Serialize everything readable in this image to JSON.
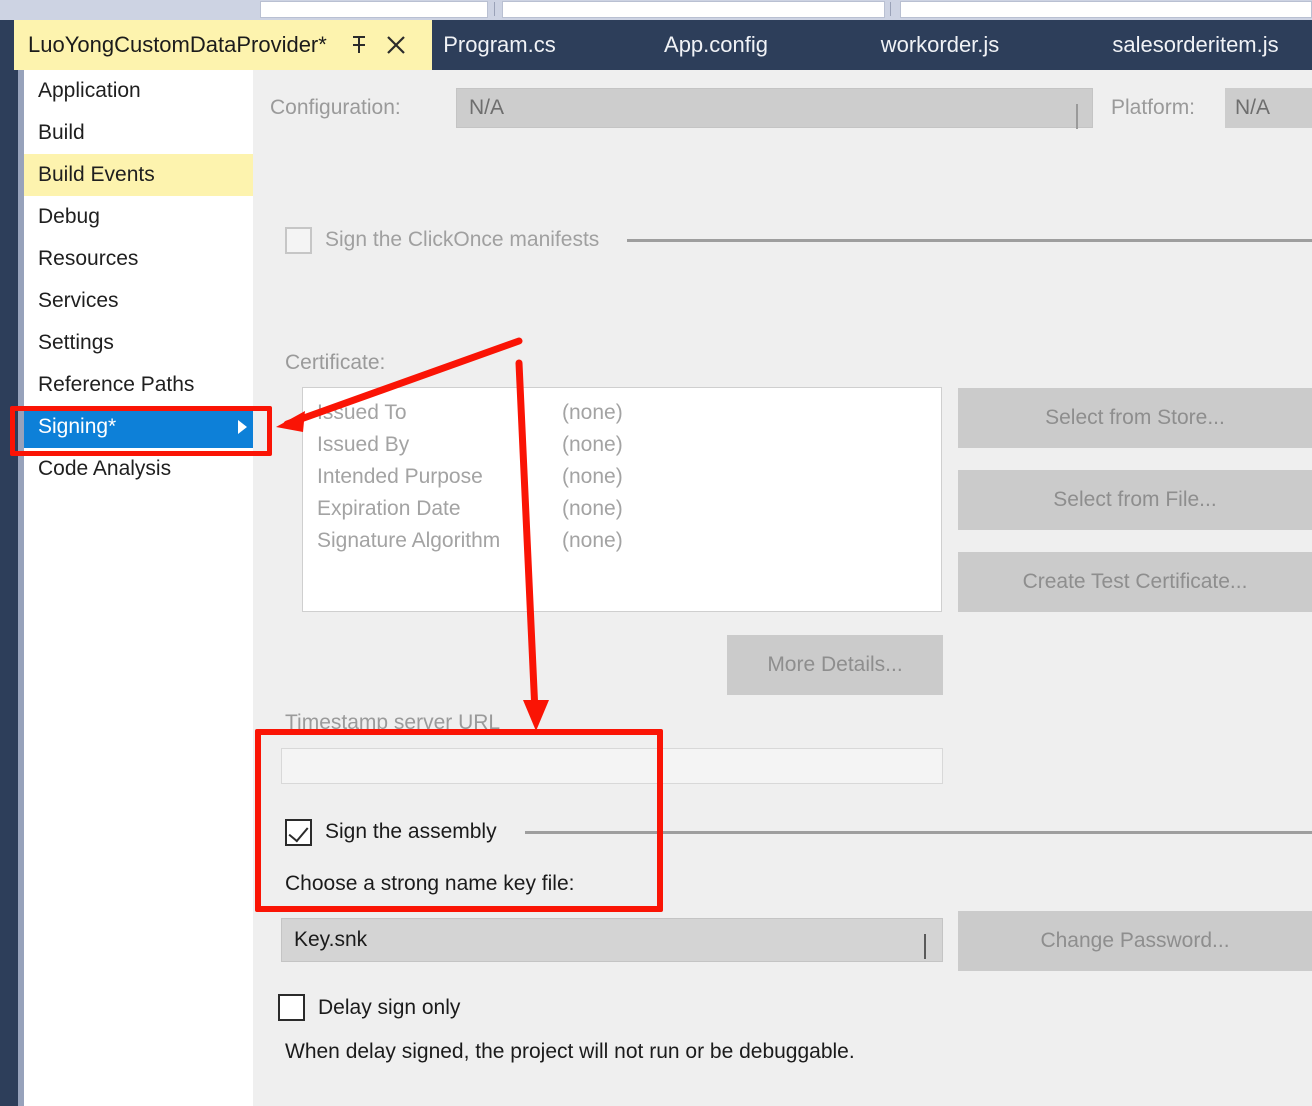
{
  "window": {
    "title": "LuoYongCustomDataProvider*"
  },
  "tabs": {
    "active": {
      "label": "LuoYongCustomDataProvider*",
      "pin_icon": "pin-icon",
      "close_icon": "close-icon"
    },
    "inactive": [
      {
        "label": "Program.cs"
      },
      {
        "label": "App.config"
      },
      {
        "label": "workorder.js"
      },
      {
        "label": "salesorderitem.js"
      }
    ]
  },
  "sidebar": {
    "items": [
      {
        "label": "Application",
        "state": "normal"
      },
      {
        "label": "Build",
        "state": "normal"
      },
      {
        "label": "Build Events",
        "state": "hovered"
      },
      {
        "label": "Debug",
        "state": "normal"
      },
      {
        "label": "Resources",
        "state": "normal"
      },
      {
        "label": "Services",
        "state": "normal"
      },
      {
        "label": "Settings",
        "state": "normal"
      },
      {
        "label": "Reference Paths",
        "state": "normal"
      },
      {
        "label": "Signing*",
        "state": "selected"
      },
      {
        "label": "Code Analysis",
        "state": "normal"
      }
    ]
  },
  "config_bar": {
    "configuration_label": "Configuration:",
    "configuration_value": "N/A",
    "platform_label": "Platform:",
    "platform_value": "N/A"
  },
  "clickonce": {
    "checkbox_label": "Sign the ClickOnce manifests",
    "checked": false,
    "enabled": false
  },
  "certificate": {
    "section_label": "Certificate:",
    "rows": [
      {
        "key": "Issued To",
        "value": "(none)"
      },
      {
        "key": "Issued By",
        "value": "(none)"
      },
      {
        "key": "Intended Purpose",
        "value": "(none)"
      },
      {
        "key": "Expiration Date",
        "value": "(none)"
      },
      {
        "key": "Signature Algorithm",
        "value": "(none)"
      }
    ],
    "buttons": {
      "select_from_store": "Select from Store...",
      "select_from_file": "Select from File...",
      "create_test_certificate": "Create Test Certificate...",
      "more_details": "More Details..."
    }
  },
  "timestamp": {
    "label": "Timestamp server URL",
    "value": "",
    "placeholder": ""
  },
  "sign_assembly": {
    "checkbox_label": "Sign the assembly",
    "checked": true,
    "strong_name_label": "Choose a strong name key file:",
    "key_file_value": "Key.snk",
    "change_password_button": "Change Password..."
  },
  "delay_sign": {
    "checkbox_label": "Delay sign only",
    "checked": false,
    "note": "When delay signed, the project will not run or be debuggable."
  },
  "colors": {
    "chrome_dark": "#2d3e5a",
    "tab_active_bg": "#fdf3ae",
    "nav_selected_bg": "#0d80d8",
    "nav_hover_bg": "#fdf3ae",
    "content_bg": "#efefef",
    "annotation_red": "#fa1405",
    "button_disabled_bg": "#cbcbcb"
  }
}
